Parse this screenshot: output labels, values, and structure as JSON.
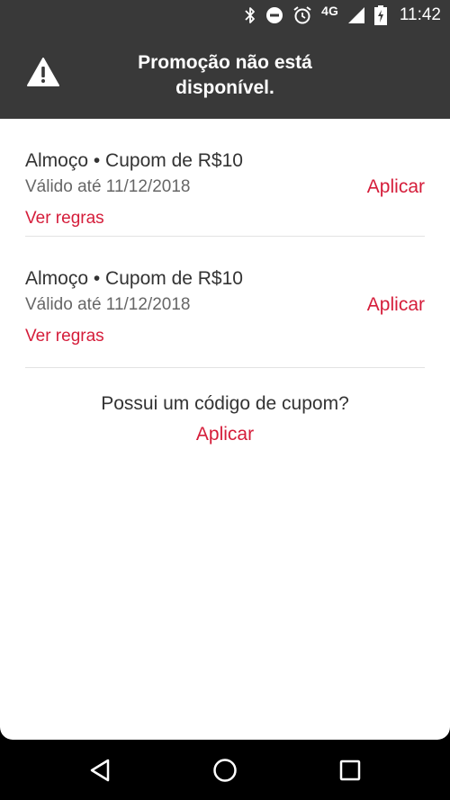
{
  "status_bar": {
    "network": "4G",
    "time": "11:42",
    "icons": [
      "bluetooth-icon",
      "do-not-disturb-icon",
      "alarm-icon",
      "signal-icon",
      "battery-charging-icon"
    ]
  },
  "banner": {
    "icon": "warning-icon",
    "message": "Promoção não está disponível."
  },
  "coupons": [
    {
      "title": "Almoço • Cupom de R$10",
      "validity": "Válido até 11/12/2018",
      "rules_label": "Ver regras",
      "apply_label": "Aplicar"
    },
    {
      "title": "Almoço • Cupom de R$10",
      "validity": "Válido até 11/12/2018",
      "rules_label": "Ver regras",
      "apply_label": "Aplicar"
    }
  ],
  "coupon_code": {
    "question": "Possui um código de cupom?",
    "apply_label": "Aplicar"
  },
  "nav_bar": {
    "icons": [
      "back-icon",
      "home-icon",
      "recents-icon"
    ]
  },
  "colors": {
    "accent": "#d51d3a",
    "banner_bg": "#393939",
    "text_primary": "#333333",
    "text_secondary": "#666666"
  }
}
